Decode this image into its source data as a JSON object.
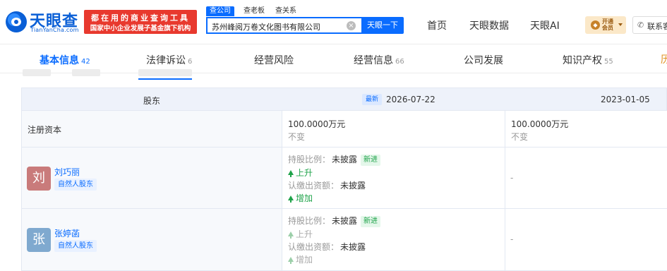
{
  "brand": {
    "logo_text": "天眼查",
    "logo_sub": "TianYanCha.com",
    "promo_line1": "都在用的商业查询工具",
    "promo_line2": "国家中小企业发展子基金旗下机构",
    "color": "#0a5fd6"
  },
  "search": {
    "tabs": [
      "查公司",
      "查老板",
      "查关系"
    ],
    "value": "苏州峰阅万卷文化图书有限公司",
    "button": "天眼一下"
  },
  "nav": [
    "首页",
    "天眼数据",
    "天眼AI"
  ],
  "vip": {
    "label": "开通会员"
  },
  "contact": {
    "label": "联系客服"
  },
  "tabs": [
    {
      "label": "基本信息",
      "count": "42"
    },
    {
      "label": "法律诉讼",
      "count": "6"
    },
    {
      "label": "经营风险",
      "count": ""
    },
    {
      "label": "经营信息",
      "count": "66"
    },
    {
      "label": "公司发展",
      "count": ""
    },
    {
      "label": "知识产权",
      "count": "55"
    }
  ],
  "tab_edge": "历",
  "table": {
    "header_label": "股东",
    "badge_latest": "最新",
    "date_latest": "2026-07-22",
    "date_prev": "2023-01-05",
    "capital_label": "注册资本",
    "capital_latest": "100.0000万元",
    "capital_latest_sub": "不变",
    "capital_prev": "100.0000万元",
    "capital_prev_sub": "不变",
    "shareholders": [
      {
        "avatar": "刘",
        "avatar_color": "#c97b7b",
        "name": "刘巧丽",
        "type": "自然人股东",
        "ratio_label": "持股比例：",
        "ratio_value": "未披露",
        "ratio_tag": "新进",
        "ratio_trend": "上升",
        "capital_label": "认缴出资额：",
        "capital_value": "未披露",
        "capital_trend": "增加",
        "prev": "-"
      },
      {
        "avatar": "张",
        "avatar_color": "#7fa9cf",
        "name": "张婷菡",
        "type": "自然人股东",
        "ratio_label": "持股比例：",
        "ratio_value": "未披露",
        "ratio_tag": "新进",
        "ratio_trend": "上升",
        "capital_label": "认缴出资额：",
        "capital_value": "未披露",
        "capital_trend": "增加",
        "prev": "-"
      }
    ]
  }
}
